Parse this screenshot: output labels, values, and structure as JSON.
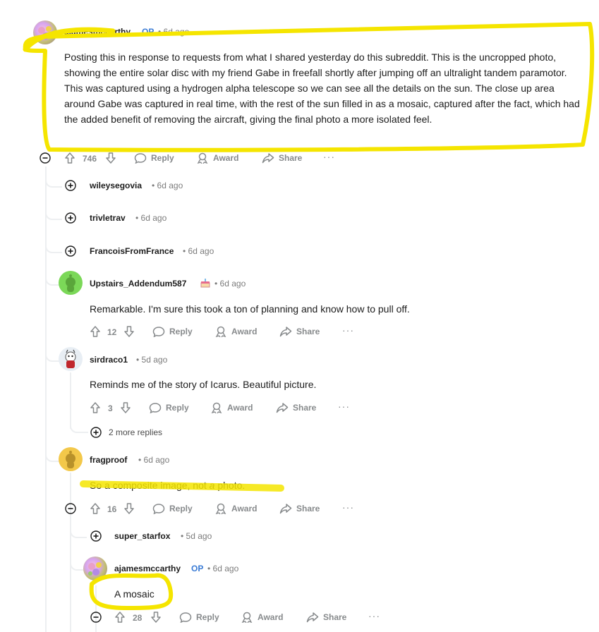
{
  "colors": {
    "highlight": "#f5e500",
    "op_badge": "#3a7bd5",
    "meta": "#7c7c7c",
    "action": "#878a8c",
    "thread_line": "#edeff1"
  },
  "comments": [
    {
      "username": "ajamesmccarthy",
      "op_badge": "OP",
      "timestamp": "• 6d ago",
      "body": "Posting this in response to requests from what I shared yesterday do this subreddit. This is the uncropped photo, showing the entire solar disc with my friend Gabe in freefall shortly after jumping off an ultralight tandem paramotor. This was captured using a hydrogen alpha telescope so we can see all the details on the sun. The close up area around Gabe was captured in real time, with the rest of the sun filled in as a mosaic, captured after the fact, which had the added benefit of removing the aircraft, giving the final photo a more isolated feel.",
      "votes": "746",
      "reply": "Reply",
      "award": "Award",
      "share": "Share",
      "more": "···"
    },
    {
      "username": "wileysegovia",
      "timestamp": "• 6d ago",
      "collapsed": true
    },
    {
      "username": "trivletrav",
      "timestamp": "• 6d ago",
      "collapsed": true
    },
    {
      "username": "FrancoisFromFrance",
      "timestamp": "• 6d ago",
      "collapsed": true
    },
    {
      "username": "Upstairs_Addendum587",
      "flair_icon": "cake-icon",
      "timestamp": "• 6d ago",
      "body": "Remarkable. I'm sure this took a ton of planning and know how to pull off.",
      "votes": "12",
      "reply": "Reply",
      "award": "Award",
      "share": "Share",
      "more": "···"
    },
    {
      "username": "sirdraco1",
      "timestamp": "• 5d ago",
      "body": "Reminds me of the story of Icarus. Beautiful picture.",
      "votes": "3",
      "reply": "Reply",
      "award": "Award",
      "share": "Share",
      "more": "···",
      "more_replies": "2 more replies"
    },
    {
      "username": "fragproof",
      "timestamp": "• 6d ago",
      "body_before": "So a composite image, not ",
      "body_emph": "a",
      "body_after": " photo.",
      "votes": "16",
      "reply": "Reply",
      "award": "Award",
      "share": "Share",
      "more": "···"
    },
    {
      "username": "super_starfox",
      "timestamp": "• 5d ago",
      "collapsed": true
    },
    {
      "username": "ajamesmccarthy",
      "op_badge": "OP",
      "timestamp": "• 6d ago",
      "body": "A mosaic",
      "votes": "28",
      "reply": "Reply",
      "award": "Award",
      "share": "Share",
      "more": "···"
    }
  ]
}
